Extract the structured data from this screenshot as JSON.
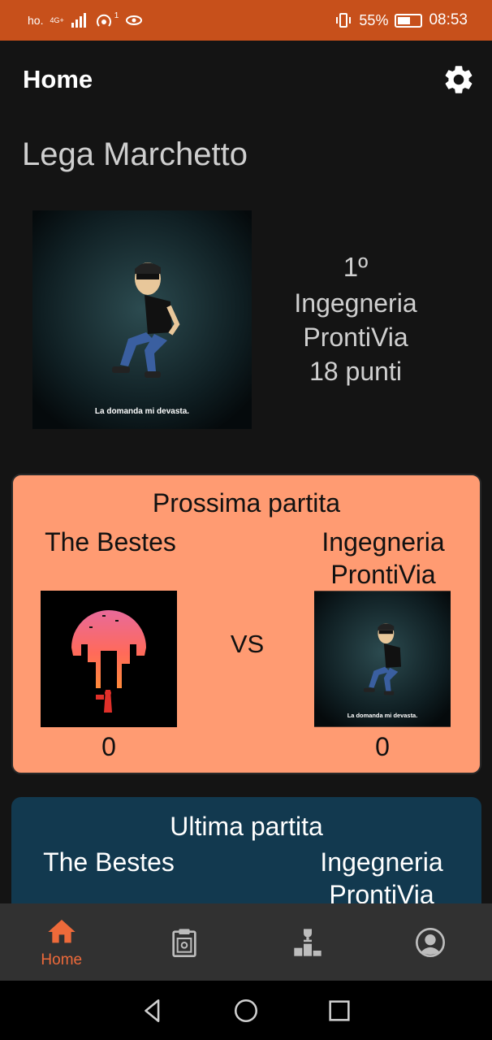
{
  "status_bar": {
    "carrier": "ho.",
    "network": "4G+",
    "notif_count": "1",
    "battery": "55%",
    "time": "08:53"
  },
  "app_bar": {
    "title": "Home"
  },
  "league": {
    "name": "Lega Marchetto"
  },
  "standing": {
    "rank": "1º",
    "team_name": "Ingegneria ProntiVia",
    "points": "18 punti",
    "avatar_caption": "La domanda mi devasta."
  },
  "next_match": {
    "title": "Prossima partita",
    "home_team": "The Bestes",
    "away_team": "Ingegneria ProntiVia",
    "vs": "VS",
    "home_score": "0",
    "away_score": "0",
    "away_avatar_caption": "La domanda mi devasta."
  },
  "last_match": {
    "title": "Ultima partita",
    "home_team": "The Bestes",
    "away_team": "Ingegneria ProntiVia"
  },
  "bottom_nav": {
    "items": [
      {
        "label": "Home",
        "icon": "home-icon",
        "active": true
      },
      {
        "label": "",
        "icon": "lineup-icon"
      },
      {
        "label": "",
        "icon": "trophy-podium-icon"
      },
      {
        "label": "",
        "icon": "profile-icon"
      }
    ]
  },
  "colors": {
    "status_bar": "#c7501b",
    "accent": "#ee6a3a",
    "next_card": "#ff9b72",
    "last_card": "#12394f",
    "background": "#141414"
  }
}
